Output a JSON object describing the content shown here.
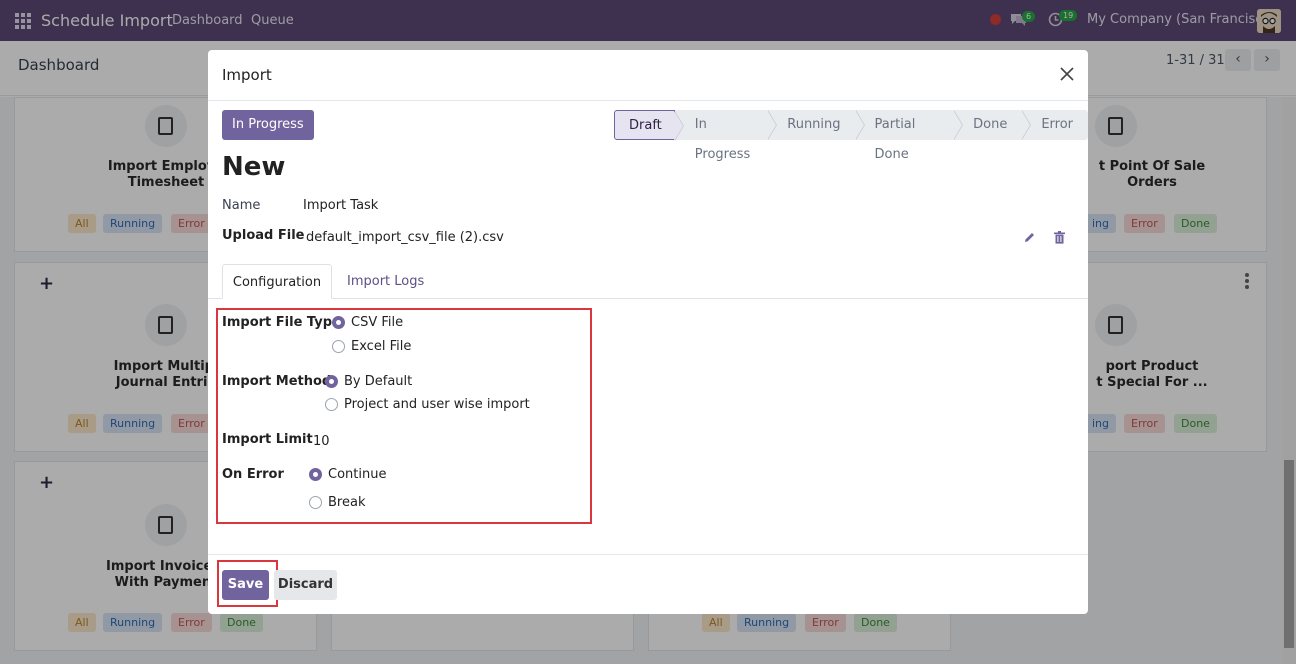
{
  "navbar": {
    "app_title": "Schedule Import",
    "menu": [
      "Dashboard",
      "Queue"
    ],
    "chat_count": "6",
    "activity_count": "19",
    "company": "My Company (San Francisco)"
  },
  "control_panel": {
    "breadcrumb": "Dashboard",
    "pager": "1-31 / 31"
  },
  "cards": [
    {
      "title_l1": "Import Employe",
      "title_l2": "Timesheet"
    },
    {
      "title_l1": "t Point Of Sale",
      "title_l2": "Orders"
    },
    {
      "title_l1": "Import Multipl",
      "title_l2": "Journal Entrie"
    },
    {
      "title_l1": "port Product",
      "title_l2": "t Special For ..."
    },
    {
      "title_l1": "Import Invoice/E",
      "title_l2": "With Payment"
    }
  ],
  "tags": {
    "all": "All",
    "running": "Running",
    "error": "Error",
    "done": "Done",
    "ing": "ing"
  },
  "modal": {
    "title": "Import",
    "status_button": "In Progress",
    "steps": [
      "Draft",
      "In Progress",
      "Running",
      "Partial Done",
      "Done",
      "Error"
    ],
    "record_title": "New",
    "name_label": "Name",
    "name_value": "Import Task",
    "upload_label": "Upload File",
    "upload_value": "default_import_csv_file (2).csv",
    "tabs": [
      "Configuration",
      "Import Logs"
    ],
    "config": {
      "file_type_label": "Import File Type",
      "file_type_options": [
        "CSV File",
        "Excel File"
      ],
      "file_type_selected": "CSV File",
      "method_label": "Import Method",
      "method_options": [
        "By Default",
        "Project and user wise import"
      ],
      "method_selected": "By Default",
      "limit_label": "Import Limit",
      "limit_value": "10",
      "on_error_label": "On Error",
      "on_error_options": [
        "Continue",
        "Break"
      ],
      "on_error_selected": "Continue"
    },
    "save_label": "Save",
    "discard_label": "Discard"
  },
  "colors": {
    "navbar": "#5b4a77",
    "primary": "#71639e",
    "highlight": "#d9363e"
  }
}
